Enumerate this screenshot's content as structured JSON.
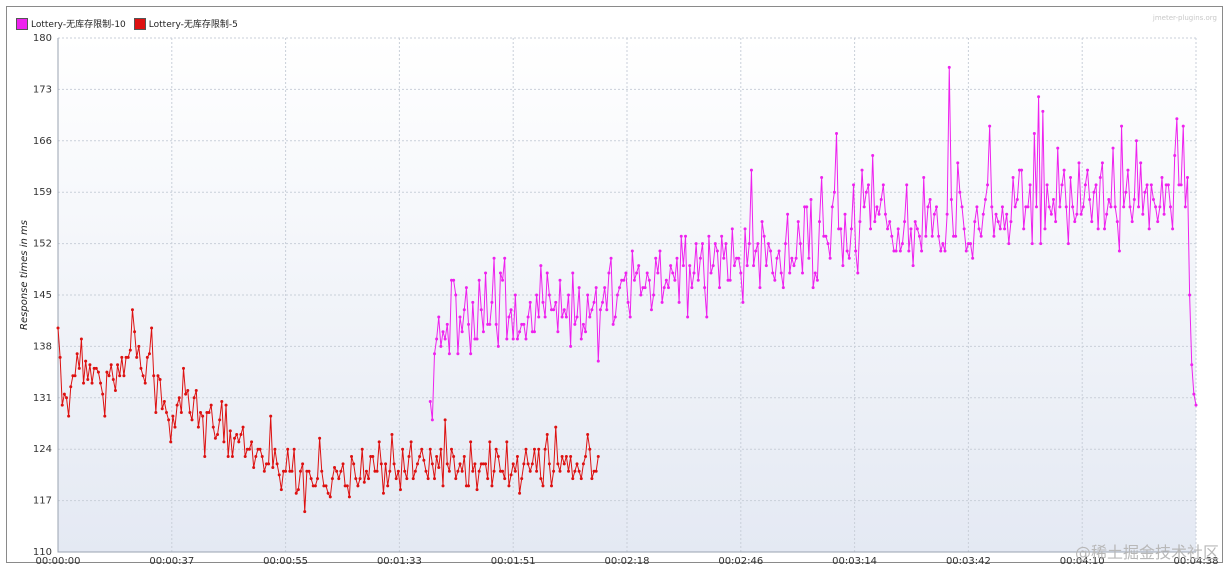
{
  "chart_data": {
    "type": "line",
    "title": "",
    "xlabel": "",
    "ylabel": "Response times in ms",
    "ylim": [
      110,
      180
    ],
    "yticks": [
      110,
      117,
      124,
      131,
      138,
      145,
      152,
      159,
      166,
      173,
      180
    ],
    "xticks": [
      "00:00:00",
      "00:00:37",
      "00:00:55",
      "00:01:33",
      "00:01:51",
      "00:02:18",
      "00:02:46",
      "00:03:14",
      "00:03:42",
      "00:04:10",
      "00:04:38"
    ],
    "grid": true,
    "legend_position": "top-left",
    "x_note": "x values are sample indices (0-310) across the test duration; tick labels are the elapsed times shown on the axis",
    "series": [
      {
        "name": "Lottery-无库存限制-5",
        "color": "#dd1111",
        "x_start": 0,
        "values": [
          140.5,
          136.5,
          130,
          131.5,
          131,
          128.5,
          132.5,
          134,
          134,
          137,
          135,
          139,
          133,
          136,
          133.5,
          135.5,
          133,
          135,
          135,
          134.5,
          133,
          131.5,
          128.5,
          134.5,
          134,
          135.5,
          133.5,
          132,
          135.5,
          134,
          136.5,
          134,
          136.5,
          136.5,
          137.5,
          143,
          140,
          136.5,
          138,
          135,
          134,
          133,
          136.5,
          137,
          140.5,
          134,
          129,
          134,
          133.5,
          129.5,
          130.5,
          129,
          128,
          125,
          128.5,
          127,
          130,
          131,
          129,
          135,
          131.5,
          132,
          129,
          128,
          131,
          132,
          127,
          129,
          128.5,
          123,
          129,
          129,
          130,
          127,
          125.5,
          126,
          128,
          130.5,
          125,
          130,
          123,
          126.5,
          123,
          125.5,
          126,
          125,
          126,
          127,
          123,
          124,
          124,
          125,
          121.5,
          123,
          124,
          124,
          123,
          121,
          122,
          122,
          128.5,
          121.5,
          124,
          122,
          120.5,
          118.5,
          121,
          121,
          124,
          121,
          121,
          124,
          118,
          118.5,
          121,
          122,
          115.5,
          121,
          121,
          120,
          119,
          119,
          120,
          125.5,
          121,
          119,
          119,
          118,
          117.5,
          120,
          121.5,
          121,
          120,
          121,
          122,
          119,
          119,
          117.5,
          123,
          122,
          120,
          119,
          120,
          124,
          119.5,
          121,
          120,
          123,
          123,
          121,
          121,
          125,
          122,
          118,
          122,
          119,
          121,
          126,
          122,
          120,
          121,
          118.5,
          124,
          121,
          120,
          123,
          125,
          120,
          121,
          122,
          123,
          124,
          122.5,
          121,
          120,
          124,
          122,
          120,
          123,
          121.5,
          124,
          119,
          128,
          122,
          121,
          124,
          123,
          120,
          121,
          122,
          121,
          123,
          119,
          119,
          125,
          121,
          122,
          118.5,
          121,
          122,
          122,
          122,
          120,
          125,
          119,
          121,
          124,
          123,
          121,
          121,
          120,
          125,
          119,
          120.5,
          122,
          121,
          123,
          118,
          120,
          122,
          124,
          122,
          121,
          122,
          124,
          121,
          124,
          120,
          119,
          124,
          126,
          122,
          119,
          121,
          127,
          122,
          121,
          123,
          122,
          123,
          121,
          123,
          120,
          121,
          122,
          121,
          120,
          122,
          123,
          126,
          124,
          120,
          121,
          121,
          123
        ]
      },
      {
        "name": "Lottery-无库存限制-10",
        "color": "#ee22ee",
        "x_start": 175,
        "values": [
          130.5,
          128,
          137,
          139,
          142,
          138,
          140,
          139,
          141,
          137,
          147,
          147,
          145,
          137,
          142,
          140,
          143,
          146,
          141,
          137,
          144,
          139,
          139,
          147,
          143,
          140,
          148,
          141,
          141,
          144,
          150,
          141,
          138,
          148,
          147,
          150,
          139,
          142,
          143,
          139,
          145,
          139,
          140,
          141,
          141,
          139,
          142,
          144,
          140,
          140,
          145,
          142,
          149,
          144,
          142,
          148,
          145,
          143,
          143,
          144,
          140,
          147,
          142,
          143,
          142,
          145,
          138,
          148,
          141,
          142,
          146,
          139,
          141,
          140,
          145,
          142,
          143,
          144,
          146,
          136,
          143,
          144,
          146,
          143,
          148,
          150,
          141,
          142,
          145,
          146,
          147,
          147,
          148,
          144,
          142,
          151,
          147,
          148,
          149,
          145,
          146,
          146,
          148,
          147,
          143,
          145,
          150,
          148,
          151,
          144,
          146,
          147,
          146,
          149,
          148,
          147,
          150,
          144,
          153,
          149,
          153,
          142,
          149,
          146,
          148,
          152,
          147,
          150,
          152,
          146,
          142,
          153,
          148,
          149,
          152,
          151,
          146,
          153,
          150,
          152,
          147,
          147,
          154,
          149,
          150,
          150,
          148,
          144,
          154,
          149,
          152,
          162,
          149,
          151,
          152,
          146,
          155,
          153,
          149,
          152,
          151,
          148,
          147,
          150,
          151,
          148,
          146,
          152,
          156,
          148,
          150,
          149,
          150,
          155,
          152,
          148,
          157,
          157,
          150,
          158,
          146,
          148,
          147,
          155,
          161,
          153,
          153,
          152,
          150,
          157,
          159,
          167,
          154,
          154,
          149,
          156,
          151,
          150,
          154,
          160,
          151,
          148,
          155,
          162,
          157,
          159,
          160,
          154,
          164,
          155,
          157,
          156,
          158,
          160,
          156,
          154,
          155,
          153,
          151,
          151,
          154,
          151,
          152,
          155,
          160,
          151,
          154,
          149,
          155,
          154,
          153,
          151,
          161,
          153,
          157,
          158,
          153,
          156,
          157,
          153,
          151,
          152,
          151,
          156,
          176,
          158,
          153,
          153,
          163,
          159,
          157,
          154,
          151,
          152,
          152,
          150,
          155,
          157,
          154,
          153,
          156,
          158,
          160,
          168,
          157,
          153,
          156,
          155,
          154,
          157,
          154,
          156,
          152,
          155,
          161,
          157,
          158,
          162,
          162,
          154,
          157,
          157,
          160,
          152,
          167,
          157,
          172,
          152,
          170,
          154,
          160,
          157,
          156,
          158,
          155,
          165,
          157,
          160,
          162,
          157,
          152,
          161,
          157,
          155,
          156,
          163,
          156,
          157,
          160,
          162,
          158,
          155,
          159,
          160,
          154,
          161,
          163,
          154,
          156,
          158,
          157,
          165,
          157,
          155,
          151,
          168,
          157,
          159,
          162,
          157,
          155,
          158,
          166,
          157,
          163,
          156,
          159,
          160,
          154,
          160,
          158,
          157,
          155,
          157,
          161,
          156,
          160,
          160,
          157,
          154,
          164,
          169,
          160,
          160,
          168,
          157,
          161,
          145,
          135.5,
          131.5,
          130
        ]
      }
    ]
  },
  "page": {
    "site_note": "jmeter-plugins.org",
    "watermark": "@稀土掘金技术社区"
  }
}
